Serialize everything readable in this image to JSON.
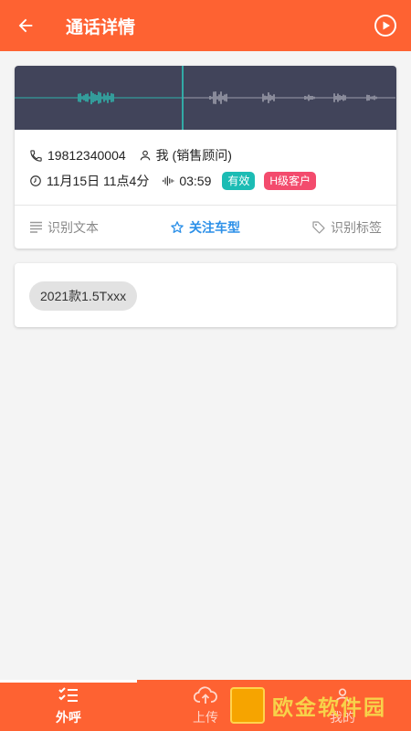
{
  "header": {
    "title": "通话详情",
    "back_icon": "arrow-back-icon",
    "play_icon": "play-circle-icon"
  },
  "call": {
    "phone": "19812340004",
    "owner": "我 (销售顾问)",
    "time": "11月15日 11点4分",
    "duration": "03:59",
    "status_badge": "有效",
    "level_badge": "H级客户",
    "colors": {
      "valid": "#1cbcb4",
      "level": "#f34b6d"
    }
  },
  "waveform": {
    "progress": 0.44,
    "played_color": "#2bd6c6",
    "unplayed_color": "#b9bac4",
    "background": "#41445a"
  },
  "actions": {
    "text": "识别文本",
    "focus_model": "关注车型",
    "tags": "识别标签"
  },
  "models": [
    "2021款1.5Txxx"
  ],
  "bottom_nav": [
    {
      "label": "外呼",
      "icon": "call-list-icon",
      "active": true
    },
    {
      "label": "上传",
      "icon": "cloud-upload-icon",
      "active": false
    },
    {
      "label": "我的",
      "icon": "person-icon",
      "active": false
    }
  ],
  "watermark": {
    "text": "欧金软件园",
    "color": "#f7d24a"
  },
  "theme": {
    "accent": "#fe6232",
    "link": "#2c90e8"
  }
}
